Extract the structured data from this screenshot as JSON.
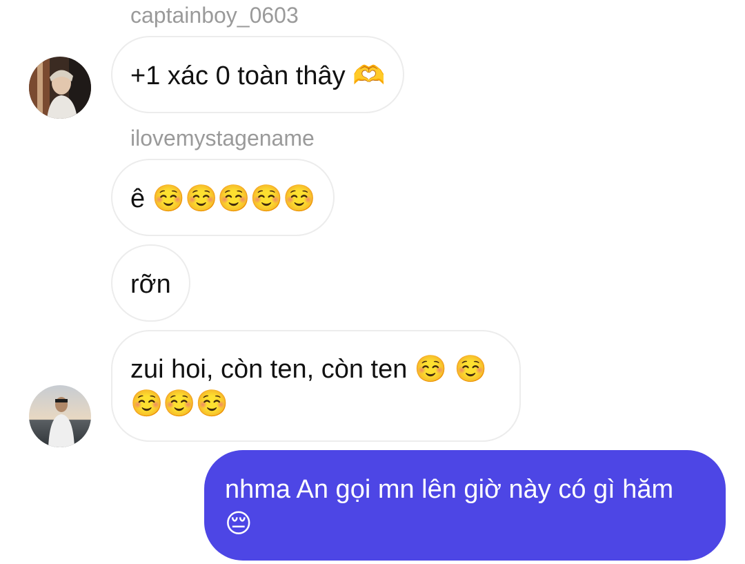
{
  "messages": [
    {
      "sender": "captainboy_0603",
      "text": "+1 xác 0 toàn thây 🫶"
    },
    {
      "sender": "ilovemystagename",
      "text": "ê ☺️☺️☺️☺️☺️"
    },
    {
      "text": "rỡn"
    },
    {
      "text": "zui hoi, còn ten, còn ten ☺️ ☺️☺️☺️☺️"
    },
    {
      "direction": "outgoing",
      "text": "nhma An gọi mn lên giờ này có gì hăm 😔"
    }
  ],
  "colors": {
    "outgoing_bubble": "#4d46e5",
    "incoming_border": "#ececec",
    "sender_name": "#9a9a9a"
  },
  "avatars": [
    {
      "owner": "captainboy_0603",
      "icon": "profile-photo"
    },
    {
      "owner": "ilovemystagename",
      "icon": "profile-photo"
    }
  ]
}
